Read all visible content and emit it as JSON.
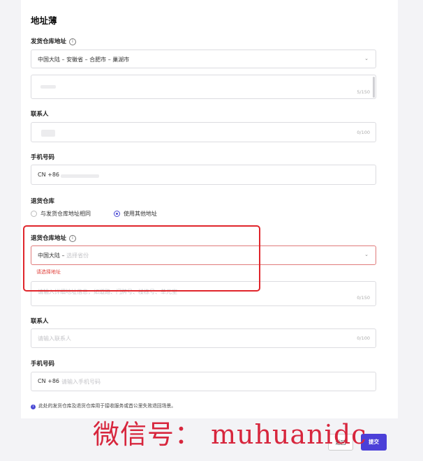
{
  "page": {
    "title": "地址薄"
  },
  "shipping": {
    "label": "发货仓库地址",
    "region_value": "中国大陆 – 安徽省 – 合肥市 – 巢湖市",
    "detail_counter": "5/150",
    "contact_label": "联系人",
    "contact_counter": "0/100",
    "phone_label": "手机号码",
    "phone_prefix": "CN +86"
  },
  "returns": {
    "label": "退货仓库",
    "option_same": "与发货仓库地址相同",
    "option_other": "使用其他地址",
    "address_label": "退货仓库地址",
    "region_value": "中国大陆 –",
    "region_placeholder": "选择省份",
    "error_text": "请选择地址",
    "detail_placeholder": "请输入详细地址信息，如道路、门牌号、楼栋号、单元室",
    "detail_counter": "0/150",
    "contact_label": "联系人",
    "contact_placeholder": "请输入联系人",
    "contact_counter": "0/100",
    "phone_label": "手机号码",
    "phone_prefix": "CN +86",
    "phone_placeholder": "请输入手机号码"
  },
  "note": {
    "text": "此处的发货仓库及退货仓库用于接收服务或首公里失败退回场景。"
  },
  "watermark": {
    "text": "微信号： muhuanidc"
  },
  "footer": {
    "back_label": "返回",
    "submit_label": "提交"
  },
  "colors": {
    "accent": "#4b3fd8",
    "error": "#e0413b",
    "highlight": "#e0252b"
  }
}
